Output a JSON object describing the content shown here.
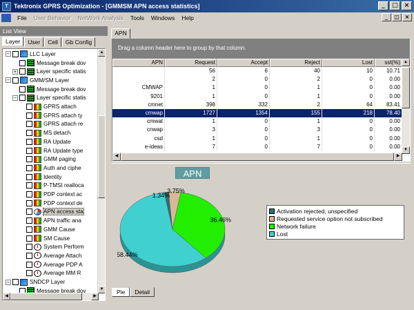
{
  "window": {
    "title": "Tektronix GPRS Optimization - [GMMSM APN access statistics]"
  },
  "menu": {
    "items": [
      {
        "label": "File",
        "enabled": true
      },
      {
        "label": "User Behavior",
        "enabled": false
      },
      {
        "label": "NetWork Analysis",
        "enabled": false
      },
      {
        "label": "Tools",
        "enabled": true
      },
      {
        "label": "Windows",
        "enabled": true
      },
      {
        "label": "Help",
        "enabled": true
      }
    ]
  },
  "list_view": {
    "title": "List View",
    "tabs": [
      "Layer",
      "User",
      "Cell",
      "Gb Config"
    ],
    "tree": [
      {
        "label": "LLC Layer",
        "level": 0,
        "expander": "-",
        "icon": "layer-icon"
      },
      {
        "label": "Message break dov",
        "level": 2,
        "icon": "grid-icon"
      },
      {
        "label": "Layer specific statis",
        "level": 1,
        "expander": "+",
        "icon": "grid-icon"
      },
      {
        "label": "GMM/SM Layer",
        "level": 0,
        "expander": "-",
        "icon": "layer-icon"
      },
      {
        "label": "Message break dov",
        "level": 2,
        "icon": "grid-icon"
      },
      {
        "label": "Layer specific statis",
        "level": 1,
        "expander": "-",
        "icon": "grid-icon"
      },
      {
        "label": "GPRS attach",
        "level": 3,
        "icon": "chart-icon"
      },
      {
        "label": "GPRS attach ty",
        "level": 3,
        "icon": "chart-icon"
      },
      {
        "label": "GPRS attach re",
        "level": 3,
        "icon": "chart-icon"
      },
      {
        "label": "MS detach",
        "level": 3,
        "icon": "chart-icon"
      },
      {
        "label": "RA Update",
        "level": 3,
        "icon": "chart-icon"
      },
      {
        "label": "RA Update type",
        "level": 3,
        "icon": "chart-icon"
      },
      {
        "label": "GMM paging",
        "level": 3,
        "icon": "chart-icon"
      },
      {
        "label": "Auth and ciphe",
        "level": 3,
        "icon": "chart-icon"
      },
      {
        "label": "Identity",
        "level": 3,
        "icon": "chart-icon"
      },
      {
        "label": "P-TMSI realloca",
        "level": 3,
        "icon": "chart-icon"
      },
      {
        "label": "PDP context ac",
        "level": 3,
        "icon": "chart-icon"
      },
      {
        "label": "PDP context de",
        "level": 3,
        "icon": "chart-icon"
      },
      {
        "label": "APN access sta",
        "level": 3,
        "icon": "pie-icon",
        "selected": true
      },
      {
        "label": "APN traffic ana",
        "level": 3,
        "icon": "chart-icon"
      },
      {
        "label": "GMM Cause",
        "level": 3,
        "icon": "chart-icon"
      },
      {
        "label": "SM Cause",
        "level": 3,
        "icon": "chart-icon"
      },
      {
        "label": "System Perform",
        "level": 3,
        "icon": "clock-icon"
      },
      {
        "label": "Average Attach",
        "level": 3,
        "icon": "clock-icon"
      },
      {
        "label": "Average PDP A",
        "level": 3,
        "icon": "clock-icon"
      },
      {
        "label": "Average MM R",
        "level": 3,
        "icon": "clock-icon"
      },
      {
        "label": "SNDCP Layer",
        "level": 0,
        "expander": "-",
        "icon": "layer-icon"
      },
      {
        "label": "Message break dov",
        "level": 2,
        "icon": "grid-icon"
      }
    ]
  },
  "main": {
    "tab": "APN",
    "group_hint": "Drag a column header here to group by that column.",
    "columns": [
      "APN",
      "Request",
      "Accept",
      "Reject",
      "Lost",
      "sst(%)"
    ],
    "rows": [
      [
        "",
        "56",
        "6",
        "40",
        "10",
        "10.71"
      ],
      [
        "",
        "2",
        "0",
        "2",
        "0",
        "0.00"
      ],
      [
        "CMWAP",
        "1",
        "0",
        "1",
        "0",
        "0.00"
      ],
      [
        "9201",
        "1",
        "0",
        "1",
        "0",
        "0.00"
      ],
      [
        "cmnet",
        "398",
        "332",
        "2",
        "64",
        "83.41"
      ],
      [
        "cmwap",
        "1727",
        "1354",
        "155",
        "218",
        "78.40"
      ],
      [
        "cmwat",
        "1",
        "0",
        "1",
        "0",
        "0.00"
      ],
      [
        "cnwap",
        "3",
        "0",
        "3",
        "0",
        "0.00"
      ],
      [
        "csd",
        "1",
        "0",
        "1",
        "0",
        "0.00"
      ],
      [
        "e-ideas",
        "7",
        "0",
        "7",
        "0",
        "0.00"
      ]
    ],
    "highlighted_row": 5,
    "bottom_tabs": [
      "Pie",
      "Detail"
    ]
  },
  "chart_data": {
    "type": "pie",
    "title": "APN",
    "labels": [
      "Activation rejected, unspecified",
      "Requested service option not subscribed",
      "Network failure",
      "Lost"
    ],
    "values": [
      1.34,
      3.75,
      36.46,
      58.44
    ],
    "data_labels": [
      "1.34%",
      "3.75%",
      "36.46%",
      "58.44%"
    ],
    "colors": [
      "#2e6e78",
      "#d8b896",
      "#22ee00",
      "#40d0d0"
    ],
    "legend_position": "right"
  }
}
